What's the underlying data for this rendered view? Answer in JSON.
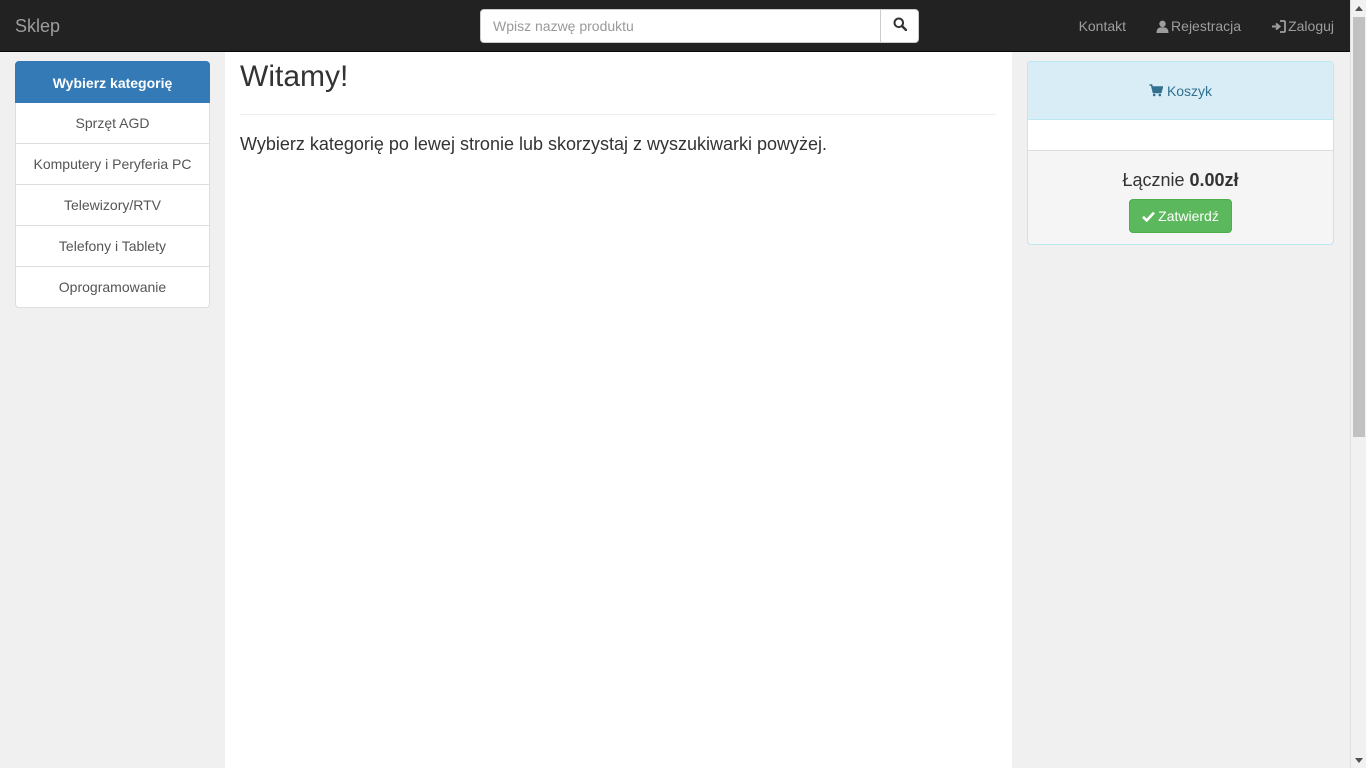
{
  "navbar": {
    "brand": "Sklep",
    "search": {
      "placeholder": "Wpisz nazwę produktu",
      "value": ""
    },
    "links": {
      "contact": "Kontakt",
      "register": "Rejestracja",
      "login": "Zaloguj"
    }
  },
  "sidebar": {
    "header": "Wybierz kategorię",
    "items": [
      {
        "label": "Sprzęt AGD"
      },
      {
        "label": "Komputery i Peryferia PC"
      },
      {
        "label": "Telewizory/RTV"
      },
      {
        "label": "Telefony i Tablety"
      },
      {
        "label": "Oprogramowanie"
      }
    ]
  },
  "main": {
    "title": "Witamy!",
    "lead": "Wybierz kategorię po lewej stronie lub skorzystaj z wyszukiwarki powyżej."
  },
  "cart": {
    "title": "Koszyk",
    "total_label": "Łącznie",
    "total_value": "0.00zł",
    "confirm_label": "Zatwierdź"
  },
  "icons": {
    "search": "search-icon",
    "user": "user-icon",
    "login": "log-in-icon",
    "cart": "shopping-cart-icon",
    "check": "check-icon"
  },
  "colors": {
    "navbar_bg": "#222222",
    "primary": "#337ab7",
    "success": "#5cb85c",
    "info_bg": "#d9edf7",
    "info_text": "#31708f"
  }
}
